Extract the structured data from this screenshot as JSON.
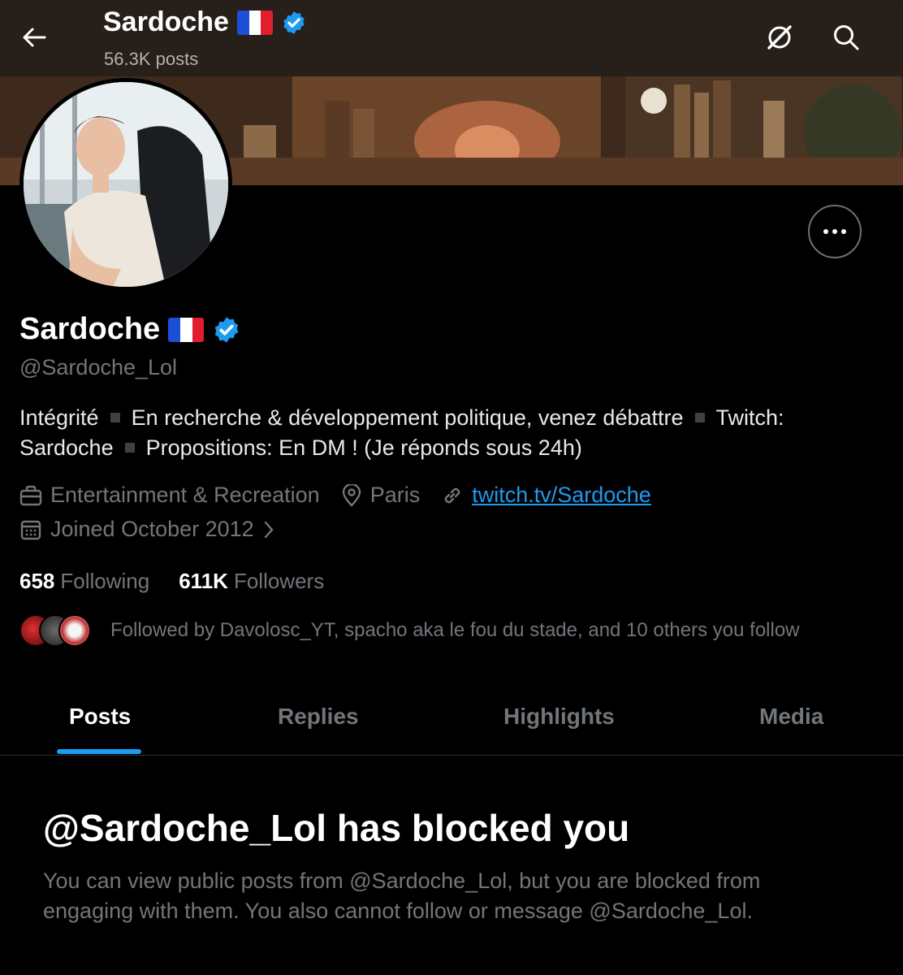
{
  "header": {
    "name": "Sardoche",
    "posts_count": "56.3K posts"
  },
  "profile": {
    "name": "Sardoche",
    "handle": "@Sardoche_Lol",
    "bio": {
      "part1": "Intégrité",
      "part2": "En recherche & développement politique, venez débattre",
      "part3": "Twitch: Sardoche",
      "part4": "Propositions: En DM ! (Je réponds sous 24h)"
    },
    "category": "Entertainment & Recreation",
    "location": "Paris",
    "website": "twitch.tv/Sardoche",
    "joined": "Joined October 2012",
    "following_count": "658",
    "following_label": "Following",
    "followers_count": "611K",
    "followers_label": "Followers",
    "followed_by": "Followed by Davolosc_YT, spacho aka le fou du stade, and 10 others you follow"
  },
  "tabs": [
    {
      "label": "Posts"
    },
    {
      "label": "Replies"
    },
    {
      "label": "Highlights"
    },
    {
      "label": "Media"
    }
  ],
  "blocked": {
    "title": "@Sardoche_Lol has blocked you",
    "message": "You can view public posts from @Sardoche_Lol, but you are blocked from engaging with them. You also cannot follow or message @Sardoche_Lol."
  },
  "colors": {
    "accent": "#1d9bf0",
    "verified": "#1d9bf0",
    "muted": "#71767b"
  },
  "icons": [
    "back-arrow-icon",
    "grok-icon",
    "search-icon",
    "ellipsis-icon",
    "verified-badge-icon",
    "france-flag-icon",
    "briefcase-icon",
    "location-pin-icon",
    "link-icon",
    "calendar-icon",
    "chevron-right-icon"
  ]
}
